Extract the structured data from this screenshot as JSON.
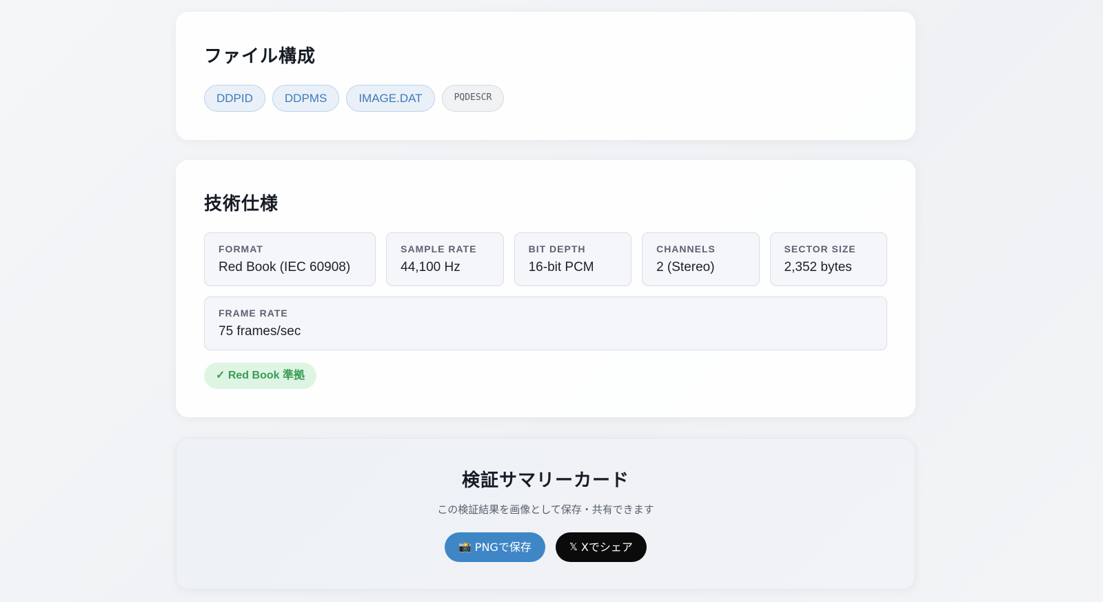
{
  "files_section": {
    "title": "ファイル構成",
    "files": [
      {
        "label": "DDPID"
      },
      {
        "label": "DDPMS"
      },
      {
        "label": "IMAGE.DAT"
      },
      {
        "label": "PQDESCR"
      }
    ]
  },
  "spec_section": {
    "title": "技術仕様",
    "specs": [
      {
        "label": "FORMAT",
        "value": "Red Book (IEC 60908)"
      },
      {
        "label": "SAMPLE RATE",
        "value": "44,100 Hz"
      },
      {
        "label": "BIT DEPTH",
        "value": "16-bit PCM"
      },
      {
        "label": "CHANNELS",
        "value": "2 (Stereo)"
      },
      {
        "label": "SECTOR SIZE",
        "value": "2,352 bytes"
      },
      {
        "label": "FRAME RATE",
        "value": "75 frames/sec"
      }
    ],
    "compliance_badge": "✓ Red Book 準拠"
  },
  "summary_section": {
    "title": "検証サマリーカード",
    "subtitle": "この検証結果を画像として保存・共有できます",
    "png_button": {
      "icon": "camera-icon",
      "label": "PNGで保存"
    },
    "share_button": {
      "icon": "x-logo-icon",
      "label": "Xでシェア"
    }
  },
  "colors": {
    "accent_blue": "#3f86c7",
    "chip_blue_text": "#3f7ab9",
    "success_green": "#3b9b55",
    "share_black": "#0b0b0b"
  }
}
